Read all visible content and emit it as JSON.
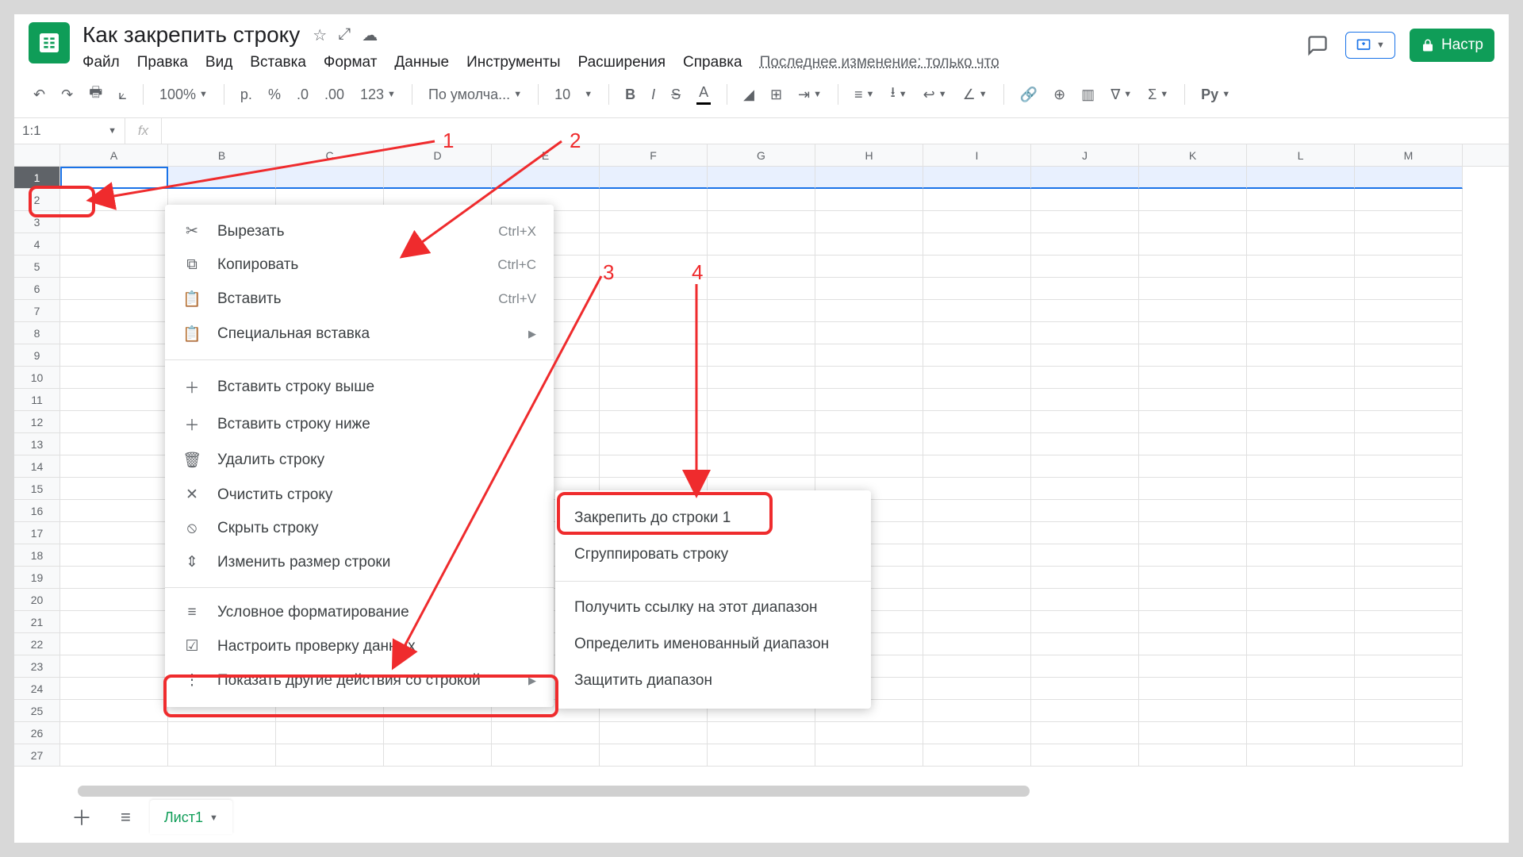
{
  "header": {
    "title": "Как закрепить строку",
    "menus": [
      "Файл",
      "Правка",
      "Вид",
      "Вставка",
      "Формат",
      "Данные",
      "Инструменты",
      "Расширения",
      "Справка"
    ],
    "last_edit": "Последнее изменение: только что",
    "share_btn": "Настр"
  },
  "toolbar": {
    "zoom": "100%",
    "currency": "р.",
    "percent": "%",
    "dec_dec": ".0",
    "dec_inc": ".00",
    "numfmt": "123",
    "font": "По умолча...",
    "size": "10",
    "py": "Py"
  },
  "fx": {
    "name": "1:1",
    "fx": "fx"
  },
  "columns": [
    "A",
    "B",
    "C",
    "D",
    "E",
    "F",
    "G",
    "H",
    "I",
    "J",
    "K",
    "L",
    "M"
  ],
  "rowcount": 27,
  "context_menu": {
    "cut": {
      "label": "Вырезать",
      "shortcut": "Ctrl+X"
    },
    "copy": {
      "label": "Копировать",
      "shortcut": "Ctrl+C"
    },
    "paste": {
      "label": "Вставить",
      "shortcut": "Ctrl+V"
    },
    "paste_special": {
      "label": "Специальная вставка"
    },
    "insert_above": {
      "label": "Вставить строку выше"
    },
    "insert_below": {
      "label": "Вставить строку ниже"
    },
    "delete_row": {
      "label": "Удалить строку"
    },
    "clear_row": {
      "label": "Очистить строку"
    },
    "hide_row": {
      "label": "Скрыть строку"
    },
    "resize_row": {
      "label": "Изменить размер строки"
    },
    "cond_format": {
      "label": "Условное форматирование"
    },
    "data_valid": {
      "label": "Настроить проверку данных"
    },
    "more_actions": {
      "label": "Показать другие действия со строкой"
    }
  },
  "submenu": {
    "freeze": "Закрепить до строки 1",
    "group": "Сгруппировать строку",
    "getlink": "Получить ссылку на этот диапазон",
    "named": "Определить именованный диапазон",
    "protect": "Защитить диапазон"
  },
  "annotations": {
    "a1": "1",
    "a2": "2",
    "a3": "3",
    "a4": "4"
  },
  "sheet_tab": "Лист1"
}
